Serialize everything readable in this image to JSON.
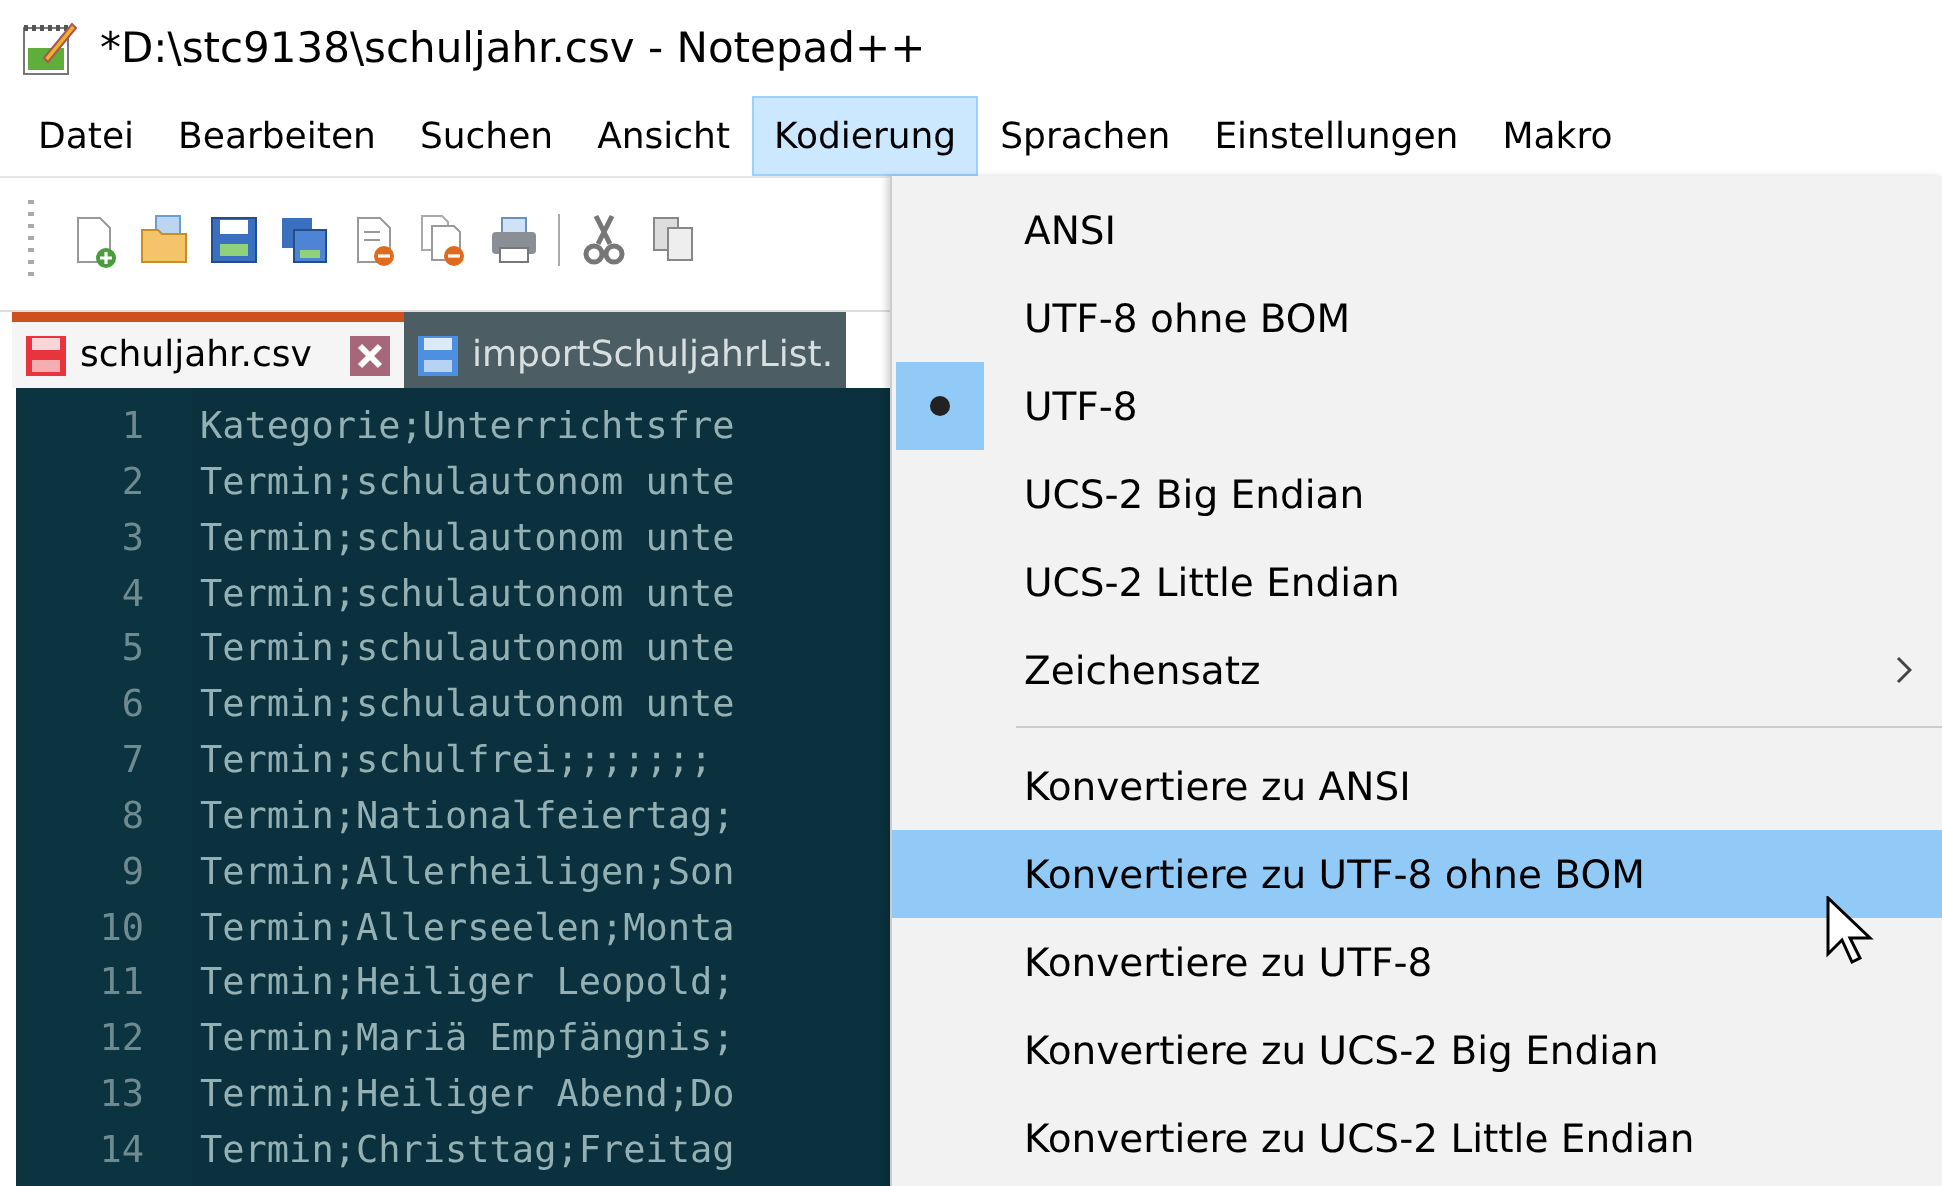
{
  "window": {
    "title": "*D:\\stc9138\\schuljahr.csv - Notepad++"
  },
  "menu_bar": [
    {
      "label": "Datei",
      "selected": false
    },
    {
      "label": "Bearbeiten",
      "selected": false
    },
    {
      "label": "Suchen",
      "selected": false
    },
    {
      "label": "Ansicht",
      "selected": false
    },
    {
      "label": "Kodierung",
      "selected": true
    },
    {
      "label": "Sprachen",
      "selected": false
    },
    {
      "label": "Einstellungen",
      "selected": false
    },
    {
      "label": "Makro",
      "selected": false
    }
  ],
  "tabs": [
    {
      "label": "schuljahr.csv",
      "selected": true,
      "modified": true
    },
    {
      "label": "importSchuljahrList.",
      "selected": false,
      "modified": false
    }
  ],
  "editor": {
    "lines": [
      {
        "number": "1",
        "text": "Kategorie;Unterrichtsfre"
      },
      {
        "number": "2",
        "text": "Termin;schulautonom unte"
      },
      {
        "number": "3",
        "text": "Termin;schulautonom unte"
      },
      {
        "number": "4",
        "text": "Termin;schulautonom unte"
      },
      {
        "number": "5",
        "text": "Termin;schulautonom unte"
      },
      {
        "number": "6",
        "text": "Termin;schulautonom unte"
      },
      {
        "number": "7",
        "text": "Termin;schulfrei;;;;;;;"
      },
      {
        "number": "8",
        "text": "Termin;Nationalfeiertag;"
      },
      {
        "number": "9",
        "text": "Termin;Allerheiligen;Son"
      },
      {
        "number": "10",
        "text": "Termin;Allerseelen;Monta"
      },
      {
        "number": "11",
        "text": "Termin;Heiliger Leopold;"
      },
      {
        "number": "12",
        "text": "Termin;Mariä Empfängnis;"
      },
      {
        "number": "13",
        "text": "Termin;Heiliger Abend;Do"
      },
      {
        "number": "14",
        "text": "Termin;Christtag;Freitag"
      }
    ]
  },
  "dropdown_menu": {
    "items": [
      {
        "kind": "item",
        "label": "ANSI",
        "checked": false,
        "highlighted": false
      },
      {
        "kind": "item",
        "label": "UTF-8 ohne BOM",
        "checked": false,
        "highlighted": false
      },
      {
        "kind": "item",
        "label": "UTF-8",
        "checked": true,
        "highlighted": false
      },
      {
        "kind": "item",
        "label": "UCS-2 Big Endian",
        "checked": false,
        "highlighted": false
      },
      {
        "kind": "item",
        "label": "UCS-2 Little Endian",
        "checked": false,
        "highlighted": false
      },
      {
        "kind": "submenu",
        "label": "Zeichensatz",
        "checked": false,
        "highlighted": false
      },
      {
        "kind": "separator"
      },
      {
        "kind": "item",
        "label": "Konvertiere zu ANSI",
        "checked": false,
        "highlighted": false
      },
      {
        "kind": "item",
        "label": "Konvertiere zu UTF-8 ohne BOM",
        "checked": false,
        "highlighted": true
      },
      {
        "kind": "item",
        "label": "Konvertiere zu UTF-8",
        "checked": false,
        "highlighted": false
      },
      {
        "kind": "item",
        "label": "Konvertiere zu UCS-2 Big Endian",
        "checked": false,
        "highlighted": false
      },
      {
        "kind": "item",
        "label": "Konvertiere zu UCS-2 Little Endian",
        "checked": false,
        "highlighted": false
      }
    ]
  }
}
